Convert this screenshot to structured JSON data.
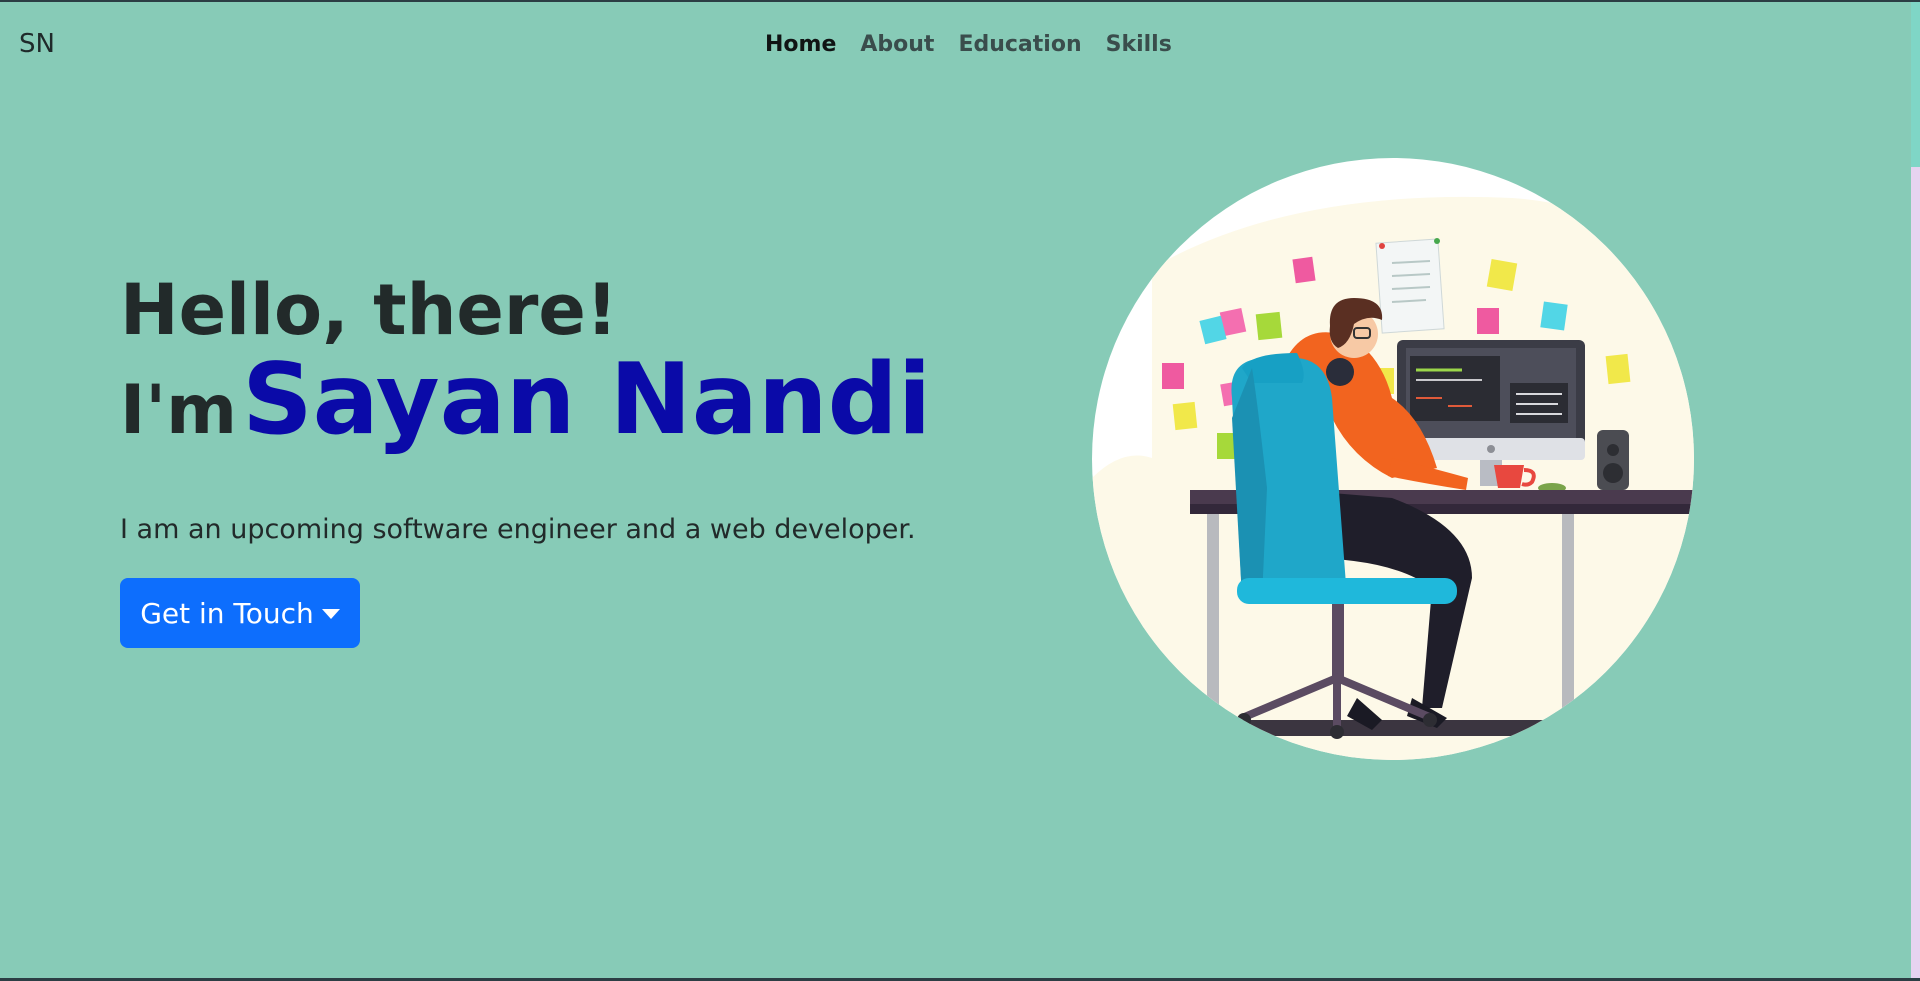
{
  "navbar": {
    "brand": "SN",
    "links": [
      "Home",
      "About",
      "Education",
      "Skills"
    ],
    "active": "Home"
  },
  "hero": {
    "greeting": "Hello, there!",
    "prefix": "I'm",
    "name": "Sayan Nandi",
    "tagline": "I am an upcoming software engineer and a web developer.",
    "cta_label": "Get in Touch"
  },
  "colors": {
    "background": "#87cbb7",
    "name_color": "#0a0aa8",
    "button": "#0d6efd"
  },
  "icons": [
    "caret-down-icon",
    "developer-illustration"
  ]
}
